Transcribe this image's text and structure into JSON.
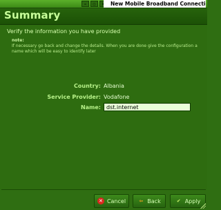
{
  "window": {
    "title": "New Mobile Broadband Connection",
    "controls": [
      "–",
      "▫",
      "×"
    ]
  },
  "page": {
    "heading": "Summary",
    "subtitle": "Verify the information you have provided",
    "note_title": "note:",
    "note_text": "If necessary go back and change the details. When you are done give the configuration a name which will be easy to identify later"
  },
  "summary": {
    "country_label": "Country:",
    "country_value": "Albania",
    "provider_label": "Service Provider:",
    "provider_value": "Vodafone",
    "name_label": "Name:",
    "name_value": "dst.internet"
  },
  "buttons": {
    "cancel_label": "Cancel",
    "back_label": "Back",
    "apply_label": "Apply"
  }
}
